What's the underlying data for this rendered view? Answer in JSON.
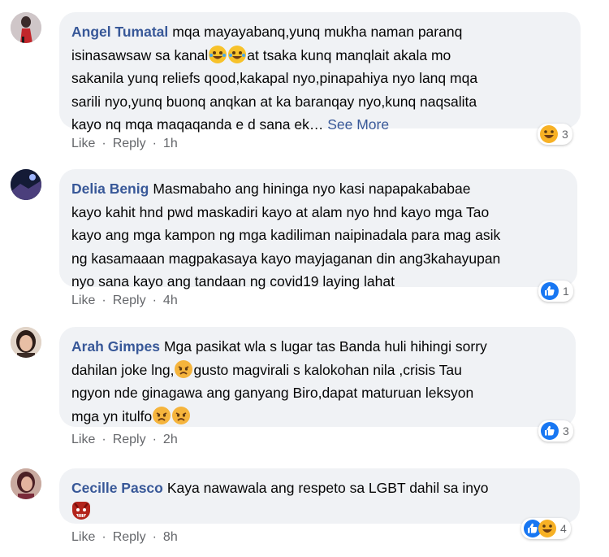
{
  "comments": [
    {
      "author": "Angel Tumatal",
      "text_lines": [
        "mqa mayayabanq,yunq mukha naman paranq",
        "isinasawsaw sa kanal",
        "at tsaka kunq manqlait akala mo",
        "sakanila yunq reliefs qood,kakapal nyo,pinapahiya nyo lanq mqa",
        "sarili nyo,yunq buonq anqkan at ka baranqay nyo,kunq naqsalita",
        "kayo nq mqa maqaqanda e d sana ek… "
      ],
      "see_more": "See More",
      "inline_emoji": [
        "laughing-crying-emoji",
        "laughing-crying-emoji"
      ],
      "like": "Like",
      "reply": "Reply",
      "time": "1h",
      "reactions": [
        "haha"
      ],
      "reaction_count": "3"
    },
    {
      "author": "Delia Benig",
      "text_lines": [
        "Masmabaho ang hininga nyo kasi napapakababae",
        "kayo kahit hnd pwd maskadiri kayo at alam nyo hnd kayo mga Tao",
        "kayo ang mga kampon ng mga kadiliman naipinadala para mag asik",
        "ng kasamaaan magpakasaya kayo mayjaganan din ang3kahayupan",
        "nyo sana kayo ang tandaan ng covid19 laying lahat"
      ],
      "like": "Like",
      "reply": "Reply",
      "time": "4h",
      "reactions": [
        "like"
      ],
      "reaction_count": "1"
    },
    {
      "author": "Arah Gimpes",
      "text_lines": [
        "Mga pasikat wla s lugar tas Banda huli hihingi sorry",
        "dahilan joke lng,",
        "gusto magvirali s kalokohan nila ,crisis Tau",
        "ngyon nde ginagawa ang ganyang Biro,dapat maturuan leksyon",
        "mga yn itulfo"
      ],
      "inline_emoji": [
        "angry-emoji",
        "angry-emoji",
        "angry-emoji"
      ],
      "like": "Like",
      "reply": "Reply",
      "time": "2h",
      "reactions": [
        "like"
      ],
      "reaction_count": "3"
    },
    {
      "author": "Cecille Pasco",
      "text_lines": [
        "Kaya nawawala ang respeto sa LGBT dahil sa inyo"
      ],
      "inline_emoji": [
        "devil-mask-emoji"
      ],
      "like": "Like",
      "reply": "Reply",
      "time": "8h",
      "reactions": [
        "like",
        "haha"
      ],
      "reaction_count": "4"
    }
  ],
  "colors": {
    "author": "#385898",
    "bubble": "#f0f2f5",
    "meta": "#65676b",
    "like_blue": "#1877f2",
    "haha_yellow": "#f7b125"
  }
}
